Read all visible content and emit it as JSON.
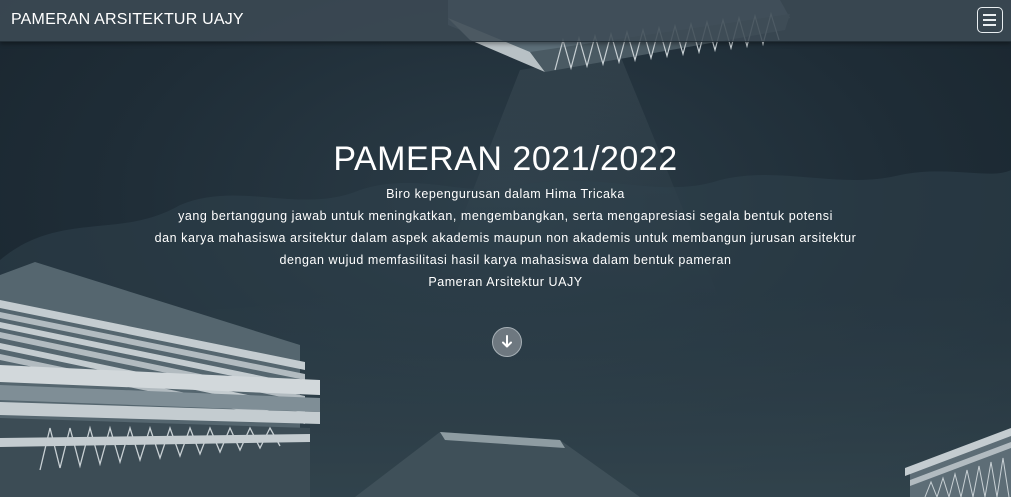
{
  "navbar": {
    "brand": "PAMERAN ARSITEKTUR UAJY",
    "menu_icon": "hamburger-menu-icon"
  },
  "hero": {
    "title": "PAMERAN 2021/2022",
    "lines": [
      "Biro kepengurusan dalam Hima Tricaka",
      "yang bertanggung jawab untuk meningkatkan, mengembangkan, serta mengapresiasi segala bentuk potensi",
      "dan karya mahasiswa arsitektur dalam aspek akademis maupun non akademis untuk membangun jurusan arsitektur",
      "dengan wujud memfasilitasi hasil karya mahasiswa dalam bentuk pameran",
      "Pameran Arsitektur UAJY"
    ],
    "scroll_icon": "arrow-down-icon"
  },
  "colors": {
    "background": "#1f2d37",
    "navbar": "#3c4a54",
    "text": "#ffffff",
    "scroll_button": "#6e7880"
  }
}
